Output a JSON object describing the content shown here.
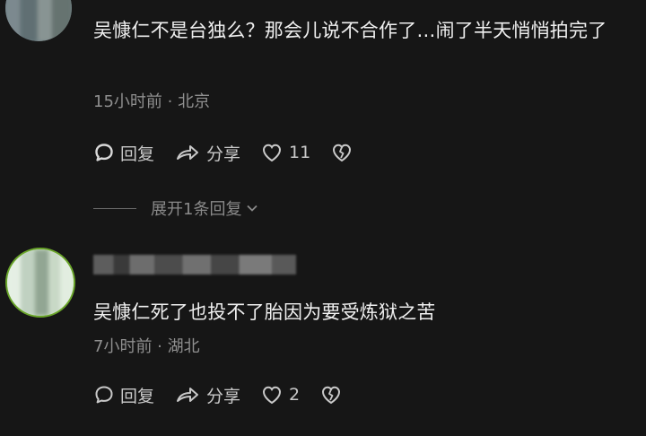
{
  "comments": [
    {
      "text": "吴慷仁不是台独么？那会儿说不合作了…闹了半天悄悄拍完了",
      "meta": "15小时前 · 北京",
      "reply_label": "回复",
      "share_label": "分享",
      "like_count": "11",
      "expand_label": "展开1条回复"
    },
    {
      "text": "吴慷仁死了也投不了胎因为要受炼狱之苦",
      "meta": "7小时前 · 湖北",
      "reply_label": "回复",
      "share_label": "分享",
      "like_count": "2"
    }
  ],
  "icons": {
    "reply": "reply-bubble-icon",
    "share": "share-arrow-icon",
    "like": "heart-outline-icon",
    "dislike": "broken-heart-icon",
    "expand": "chevron-down-icon"
  },
  "colors": {
    "background": "#161616",
    "text": "#f0f0f0",
    "meta": "#8f8f8f",
    "action": "#c9c9c9"
  }
}
